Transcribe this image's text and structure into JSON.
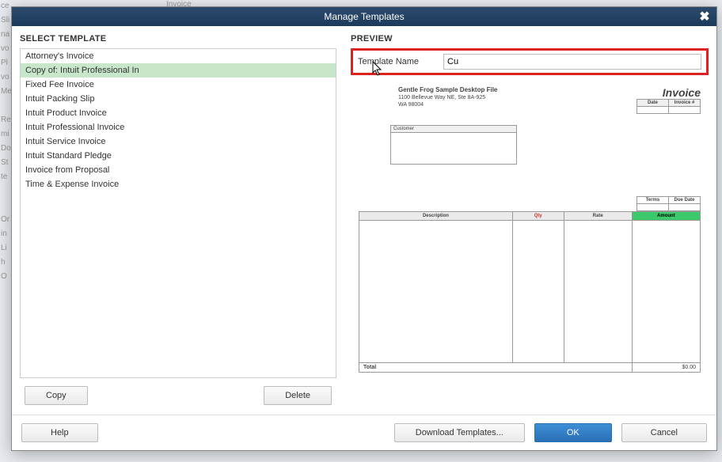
{
  "bg": {
    "invoice": "Invoice"
  },
  "dialog": {
    "title": "Manage Templates",
    "selectTemplateHeader": "SELECT TEMPLATE",
    "previewHeader": "PREVIEW",
    "templates": [
      "Attorney's Invoice",
      "Copy of: Intuit Professional In",
      "Fixed Fee Invoice",
      "Intuit Packing Slip",
      "Intuit Product Invoice",
      "Intuit Professional Invoice",
      "Intuit Service Invoice",
      "Intuit Standard Pledge",
      "Invoice from Proposal",
      "Time & Expense Invoice"
    ],
    "selectedIndex": 1,
    "buttons": {
      "copy": "Copy",
      "delete": "Delete",
      "help": "Help",
      "download": "Download Templates...",
      "ok": "OK",
      "cancel": "Cancel"
    },
    "nameLabel": "Template Name",
    "nameValue": "Cu"
  },
  "invoicePreview": {
    "companyName": "Gentle Frog Sample Desktop File",
    "addr1": "1100 Bellevue Way NE, Ste 8A-925",
    "addr2": "WA 98004",
    "title": "Invoice",
    "meta": {
      "dateH": "Date",
      "invH": "Invoice #"
    },
    "customerH": "Customer",
    "termsH": "Terms",
    "dueH": "Due Date",
    "cols": {
      "desc": "Description",
      "qty": "Qty",
      "rate": "Rate",
      "amount": "Amount"
    },
    "totalLabel": "Total",
    "totalValue": "$0.00"
  },
  "sidebarFrag": [
    "ce",
    "Sli",
    "na",
    "vo",
    "Pl",
    "vo",
    "Me",
    "",
    "Re",
    "mi",
    "Do",
    "St",
    "te",
    "",
    "",
    "Or",
    "in",
    "Li",
    "h",
    "O"
  ]
}
